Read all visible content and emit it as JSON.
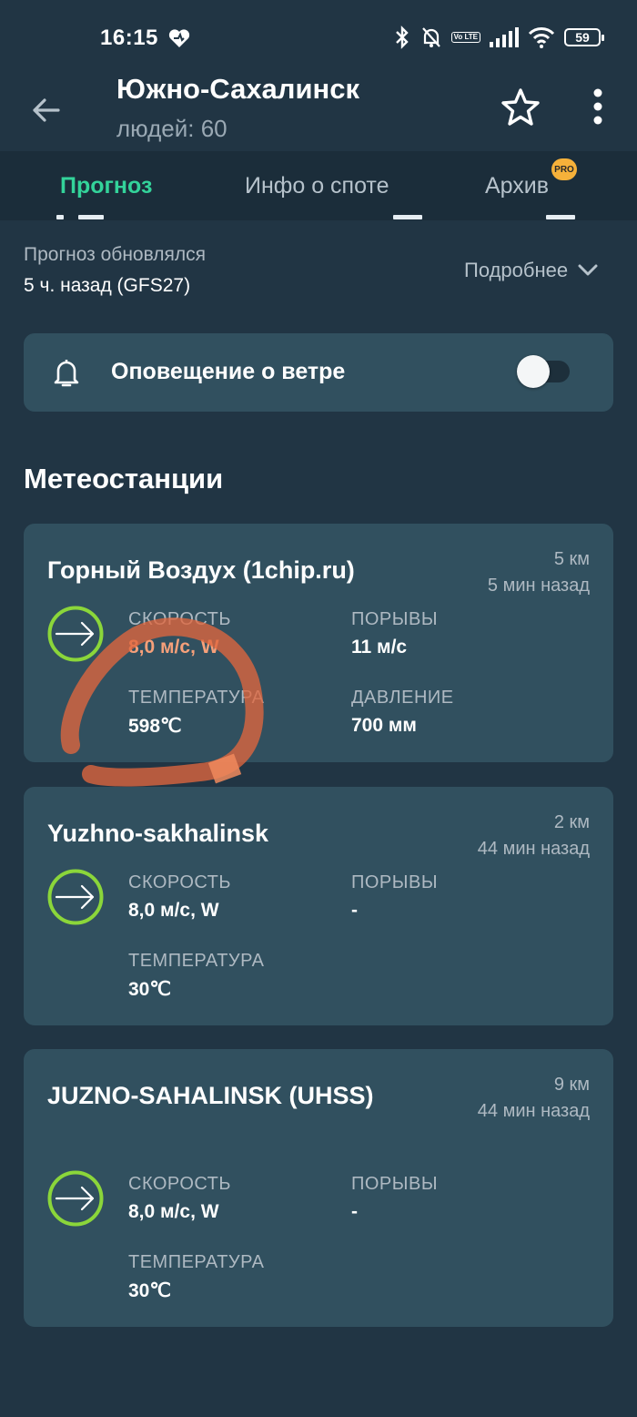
{
  "status_bar": {
    "time": "16:15",
    "volte": "Vo LTE",
    "battery": "59"
  },
  "header": {
    "title": "Южно-Сахалинск",
    "subtitle": "людей: 60"
  },
  "tabs": [
    {
      "label": "Прогноз",
      "active": true
    },
    {
      "label": "Инфо о споте",
      "active": false
    },
    {
      "label": "Архив",
      "active": false,
      "badge": "PRO"
    }
  ],
  "update": {
    "label": "Прогноз обновлялся",
    "value": "5 ч. назад (GFS27)",
    "more": "Подробнее"
  },
  "alert": {
    "label": "Оповещение о ветре",
    "enabled": false
  },
  "stations_title": "Метеостанции",
  "stations": [
    {
      "name": "Горный Воздух (1chip.ru)",
      "distance": "5 км",
      "ago": "5 мин назад",
      "speed_label": "СКОРОСТЬ",
      "speed": "8,0 м/с, W",
      "gusts_label": "ПОРЫВЫ",
      "gusts": "11 м/с",
      "temp_label": "ТЕМПЕРАТУРА",
      "temp": "598℃",
      "pressure_label": "ДАВЛЕНИЕ",
      "pressure": "700 мм"
    },
    {
      "name": "Yuzhno-sakhalinsk",
      "distance": "2 км",
      "ago": "44 мин назад",
      "speed_label": "СКОРОСТЬ",
      "speed": "8,0 м/с, W",
      "gusts_label": "ПОРЫВЫ",
      "gusts": "-",
      "temp_label": "ТЕМПЕРАТУРА",
      "temp": "30℃"
    },
    {
      "name": "JUZNO-SAHALINSK (UHSS)",
      "distance": "9 км",
      "ago": "44 мин назад",
      "speed_label": "СКОРОСТЬ",
      "speed": "8,0 м/с, W",
      "gusts_label": "ПОРЫВЫ",
      "gusts": "-",
      "temp_label": "ТЕМПЕРАТУРА",
      "temp": "30℃"
    }
  ],
  "colors": {
    "background": "#213544",
    "card": "#31505f",
    "accent_green": "#33d39a",
    "arrow_ring": "#8bd63a",
    "highlight_orange": "#f08a5d",
    "pro_badge": "#f6b13a"
  },
  "icons": [
    "back-arrow-icon",
    "star-icon",
    "more-vert-icon",
    "bell-icon",
    "chevron-down-icon",
    "wind-direction-icon"
  ]
}
